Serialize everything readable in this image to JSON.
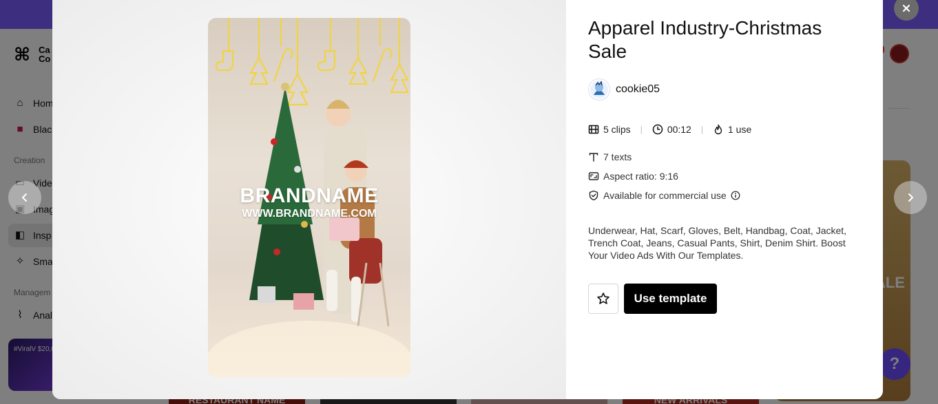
{
  "background": {
    "logo_text": "Ca Co",
    "sidebar": [
      {
        "label": "Home",
        "icon": "home-icon"
      },
      {
        "label": "Blac",
        "icon": "bag-icon"
      },
      {
        "label": "Video",
        "icon": "video-icon"
      },
      {
        "label": "Imag",
        "icon": "image-icon"
      },
      {
        "label": "Insp",
        "icon": "inspiration-icon"
      },
      {
        "label": "Sma",
        "icon": "magic-icon"
      },
      {
        "label": "Anal",
        "icon": "analytics-icon"
      }
    ],
    "sections": {
      "creation": "Creation",
      "management": "Managem"
    },
    "promo_text": "#ViralV $20,0",
    "right_card_text": "ALE",
    "bottom_cards": [
      "RESTAURANT NAME",
      "",
      "",
      "NEW ARRIVALS"
    ],
    "help_icon": "?"
  },
  "modal": {
    "preview": {
      "brand_title": "BRANDNAME",
      "brand_url": "WWW.BRANDNAME.COM"
    },
    "title": "Apparel Industry-Christmas Sale",
    "author": {
      "name": "cookie05"
    },
    "stats": {
      "clips": "5 clips",
      "duration": "00:12",
      "uses": "1 use"
    },
    "meta": {
      "texts": "7 texts",
      "aspect_ratio": "Aspect ratio: 9:16",
      "commercial": "Available for commercial use"
    },
    "description": "Underwear, Hat, Scarf, Gloves, Belt, Handbag, Coat, Jacket, Trench Coat, Jeans, Casual Pants, Shirt, Denim Shirt. Boost Your Video Ads With Our Templates.",
    "use_button_label": "Use template",
    "close_icon": "×",
    "prev_icon": "‹",
    "next_icon": "›"
  },
  "colors": {
    "accent_purple": "#7c5cff",
    "button_black": "#000000",
    "ornament_yellow": "#f2d43a"
  }
}
